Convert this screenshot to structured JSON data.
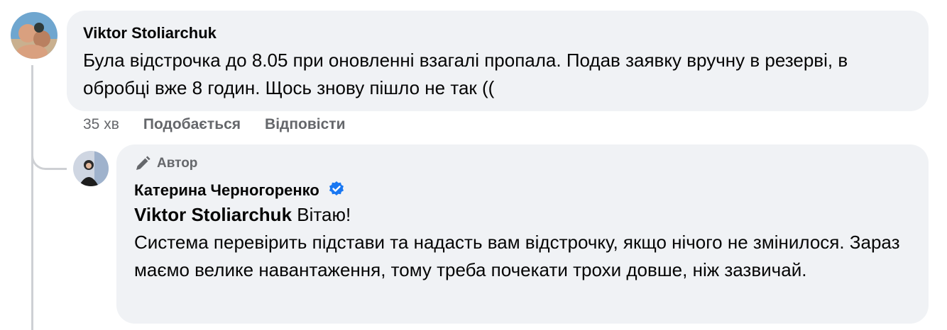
{
  "comment": {
    "author": "Viktor Stoliarchuk",
    "text": "Була відстрочка до 8.05 при оновленні взагалі пропала. Подав заявку вручну в резерві, в обробці вже 8 годин. Щось знову пішло не так ((",
    "time": "35 хв",
    "like_label": "Подобається",
    "reply_label": "Відповісти"
  },
  "reply": {
    "author_badge": "Автор",
    "author": "Катерина Черногоренко",
    "mention": "Viktor Stoliarchuk",
    "greeting": "Вітаю!",
    "text": "Система перевірить підстави та надасть вам відстрочку, якщо нічого не змінилося. Зараз маємо велике навантаження, тому треба почекати трохи довше, ніж зазвичай."
  },
  "icons": {
    "badge": "pen-icon",
    "verified": "verified-badge-icon"
  },
  "colors": {
    "bubble": "#f0f2f5",
    "secondary_text": "#65676b",
    "verified": "#1877f2"
  }
}
